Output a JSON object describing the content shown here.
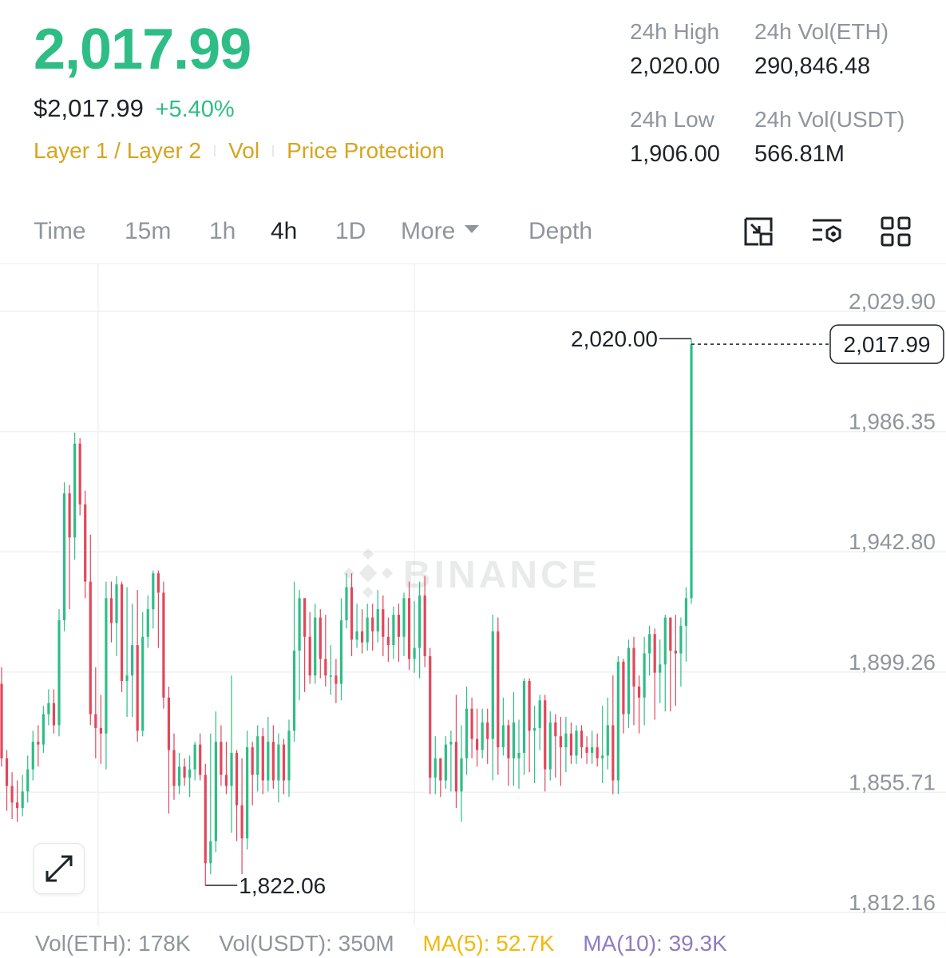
{
  "ticker": {
    "last_price": "2,017.99",
    "usd_price": "$2,017.99",
    "change_pct": "+5.40%",
    "tags": [
      "Layer 1 / Layer 2",
      "Vol",
      "Price Protection"
    ]
  },
  "stats": {
    "high_label": "24h High",
    "high_value": "2,020.00",
    "low_label": "24h Low",
    "low_value": "1,906.00",
    "vol_eth_label": "24h Vol(ETH)",
    "vol_eth_value": "290,846.48",
    "vol_usdt_label": "24h Vol(USDT)",
    "vol_usdt_value": "566.81M"
  },
  "tabs": {
    "time": "Time",
    "m15": "15m",
    "h1": "1h",
    "h4": "4h",
    "d1": "1D",
    "more": "More",
    "depth": "Depth",
    "active": "4h"
  },
  "icons": {
    "tools": [
      "chart-mode-icon",
      "chart-settings-icon",
      "layout-grid-icon"
    ],
    "expand": "expand-arrows-icon"
  },
  "colors": {
    "up": "#2ebd85",
    "down": "#e0475b",
    "accent": "#d6a51e",
    "ma5": "#f0b90b",
    "ma10": "#8e7cc3"
  },
  "chart_data": {
    "type": "candlestick",
    "interval": "4h",
    "watermark": "BINANCE",
    "y_ticks": [
      "2,029.90",
      "1,986.35",
      "1,942.80",
      "1,899.26",
      "1,855.71",
      "1,812.16"
    ],
    "ylim": [
      1812.16,
      2029.9
    ],
    "high_marker": "2,020.00",
    "low_marker": "1,822.06",
    "last_price_tag": "2,017.99",
    "candles": [
      [
        1895,
        1868,
        1901,
        1865
      ],
      [
        1868,
        1858,
        1871,
        1849
      ],
      [
        1858,
        1852,
        1863,
        1846
      ],
      [
        1852,
        1850,
        1860,
        1845
      ],
      [
        1850,
        1856,
        1862,
        1847
      ],
      [
        1856,
        1864,
        1869,
        1852
      ],
      [
        1864,
        1874,
        1878,
        1860
      ],
      [
        1874,
        1873,
        1880,
        1865
      ],
      [
        1873,
        1884,
        1887,
        1870
      ],
      [
        1884,
        1888,
        1893,
        1880
      ],
      [
        1888,
        1880,
        1893,
        1877
      ],
      [
        1880,
        1918,
        1922,
        1876
      ],
      [
        1918,
        1964,
        1968,
        1914
      ],
      [
        1964,
        1948,
        1967,
        1922
      ],
      [
        1948,
        1982,
        1986,
        1940
      ],
      [
        1982,
        1960,
        1984,
        1956
      ],
      [
        1960,
        1932,
        1965,
        1926
      ],
      [
        1932,
        1884,
        1949,
        1880
      ],
      [
        1884,
        1879,
        1901,
        1868
      ],
      [
        1879,
        1877,
        1891,
        1866
      ],
      [
        1877,
        1926,
        1932,
        1864
      ],
      [
        1926,
        1917,
        1932,
        1910
      ],
      [
        1917,
        1931,
        1934,
        1905
      ],
      [
        1931,
        1896,
        1932,
        1892
      ],
      [
        1896,
        1898,
        1930,
        1883
      ],
      [
        1898,
        1909,
        1924,
        1883
      ],
      [
        1909,
        1878,
        1929,
        1874
      ],
      [
        1878,
        1912,
        1921,
        1876
      ],
      [
        1912,
        1922,
        1927,
        1908
      ],
      [
        1922,
        1935,
        1936,
        1915
      ],
      [
        1935,
        1928,
        1936,
        1908
      ],
      [
        1928,
        1890,
        1932,
        1886
      ],
      [
        1890,
        1871,
        1894,
        1848
      ],
      [
        1871,
        1858,
        1877,
        1853
      ],
      [
        1858,
        1865,
        1870,
        1855
      ],
      [
        1865,
        1861,
        1868,
        1858
      ],
      [
        1861,
        1864,
        1869,
        1854
      ],
      [
        1864,
        1873,
        1874,
        1860
      ],
      [
        1873,
        1862,
        1877,
        1860
      ],
      [
        1862,
        1830,
        1866,
        1822
      ],
      [
        1830,
        1838,
        1877,
        1826
      ],
      [
        1838,
        1874,
        1885,
        1834
      ],
      [
        1874,
        1862,
        1880,
        1858
      ],
      [
        1862,
        1858,
        1874,
        1855
      ],
      [
        1858,
        1870,
        1898,
        1841
      ],
      [
        1870,
        1851,
        1871,
        1838
      ],
      [
        1851,
        1839,
        1868,
        1826
      ],
      [
        1839,
        1872,
        1878,
        1835
      ],
      [
        1872,
        1862,
        1874,
        1851
      ],
      [
        1862,
        1876,
        1880,
        1856
      ],
      [
        1876,
        1860,
        1879,
        1855
      ],
      [
        1860,
        1874,
        1883,
        1856
      ],
      [
        1874,
        1860,
        1880,
        1857
      ],
      [
        1860,
        1873,
        1877,
        1852
      ],
      [
        1873,
        1860,
        1875,
        1855
      ],
      [
        1860,
        1878,
        1882,
        1854
      ],
      [
        1878,
        1907,
        1932,
        1874
      ],
      [
        1907,
        1926,
        1929,
        1889
      ],
      [
        1926,
        1912,
        1926,
        1892
      ],
      [
        1912,
        1898,
        1921,
        1895
      ],
      [
        1898,
        1919,
        1924,
        1895
      ],
      [
        1919,
        1904,
        1922,
        1897
      ],
      [
        1904,
        1898,
        1920,
        1894
      ],
      [
        1898,
        1898,
        1909,
        1891
      ],
      [
        1898,
        1895,
        1904,
        1888
      ],
      [
        1895,
        1918,
        1926,
        1889
      ],
      [
        1918,
        1930,
        1935,
        1915
      ],
      [
        1930,
        1911,
        1935,
        1905
      ],
      [
        1911,
        1914,
        1924,
        1908
      ],
      [
        1914,
        1910,
        1922,
        1906
      ],
      [
        1910,
        1919,
        1924,
        1907
      ],
      [
        1919,
        1914,
        1924,
        1907
      ],
      [
        1914,
        1922,
        1929,
        1910
      ],
      [
        1922,
        1912,
        1927,
        1905
      ],
      [
        1912,
        1909,
        1919,
        1903
      ],
      [
        1909,
        1920,
        1923,
        1904
      ],
      [
        1920,
        1912,
        1924,
        1903
      ],
      [
        1912,
        1926,
        1928,
        1905
      ],
      [
        1926,
        1904,
        1932,
        1900
      ],
      [
        1904,
        1908,
        1925,
        1899
      ],
      [
        1908,
        1927,
        1932,
        1897
      ],
      [
        1927,
        1905,
        1934,
        1901
      ],
      [
        1905,
        1861,
        1908,
        1855
      ],
      [
        1861,
        1868,
        1876,
        1855
      ],
      [
        1868,
        1860,
        1868,
        1854
      ],
      [
        1860,
        1873,
        1876,
        1857
      ],
      [
        1873,
        1874,
        1878,
        1856
      ],
      [
        1874,
        1856,
        1891,
        1850
      ],
      [
        1856,
        1868,
        1880,
        1845
      ],
      [
        1868,
        1886,
        1894,
        1862
      ],
      [
        1886,
        1875,
        1890,
        1868
      ],
      [
        1875,
        1871,
        1886,
        1865
      ],
      [
        1871,
        1881,
        1886,
        1868
      ],
      [
        1881,
        1875,
        1886,
        1866
      ],
      [
        1875,
        1914,
        1920,
        1860
      ],
      [
        1914,
        1872,
        1919,
        1862
      ],
      [
        1872,
        1880,
        1890,
        1869
      ],
      [
        1880,
        1868,
        1882,
        1858
      ],
      [
        1868,
        1881,
        1892,
        1858
      ],
      [
        1868,
        1870,
        1882,
        1857
      ],
      [
        1870,
        1896,
        1897,
        1862
      ],
      [
        1896,
        1878,
        1897,
        1863
      ],
      [
        1878,
        1879,
        1887,
        1859
      ],
      [
        1879,
        1889,
        1891,
        1871
      ],
      [
        1889,
        1864,
        1891,
        1856
      ],
      [
        1864,
        1881,
        1885,
        1860
      ],
      [
        1881,
        1876,
        1884,
        1861
      ],
      [
        1876,
        1872,
        1883,
        1858
      ],
      [
        1872,
        1877,
        1883,
        1863
      ],
      [
        1877,
        1869,
        1881,
        1866
      ],
      [
        1869,
        1878,
        1880,
        1866
      ],
      [
        1878,
        1872,
        1880,
        1868
      ],
      [
        1872,
        1870,
        1876,
        1866
      ],
      [
        1870,
        1872,
        1878,
        1866
      ],
      [
        1872,
        1868,
        1877,
        1865
      ],
      [
        1868,
        1869,
        1887,
        1859
      ],
      [
        1869,
        1880,
        1890,
        1864
      ],
      [
        1880,
        1860,
        1898,
        1855
      ],
      [
        1860,
        1903,
        1905,
        1855
      ],
      [
        1903,
        1884,
        1904,
        1877
      ],
      [
        1884,
        1908,
        1911,
        1879
      ],
      [
        1908,
        1894,
        1912,
        1880
      ],
      [
        1894,
        1890,
        1898,
        1877
      ],
      [
        1890,
        1906,
        1912,
        1880
      ],
      [
        1906,
        1913,
        1916,
        1898
      ],
      [
        1913,
        1899,
        1915,
        1882
      ],
      [
        1899,
        1902,
        1911,
        1888
      ],
      [
        1902,
        1919,
        1920,
        1885
      ],
      [
        1919,
        1907,
        1918,
        1885
      ],
      [
        1907,
        1906,
        1920,
        1887
      ],
      [
        1906,
        1916,
        1919,
        1894
      ],
      [
        1916,
        1926,
        1930,
        1903
      ],
      [
        1926,
        2018,
        2020,
        1924
      ]
    ]
  },
  "volume_row": {
    "vol_eth": "Vol(ETH): 178K",
    "vol_usdt": "Vol(USDT): 350M",
    "ma5": "MA(5): 52.7K",
    "ma10": "MA(10): 39.3K"
  }
}
